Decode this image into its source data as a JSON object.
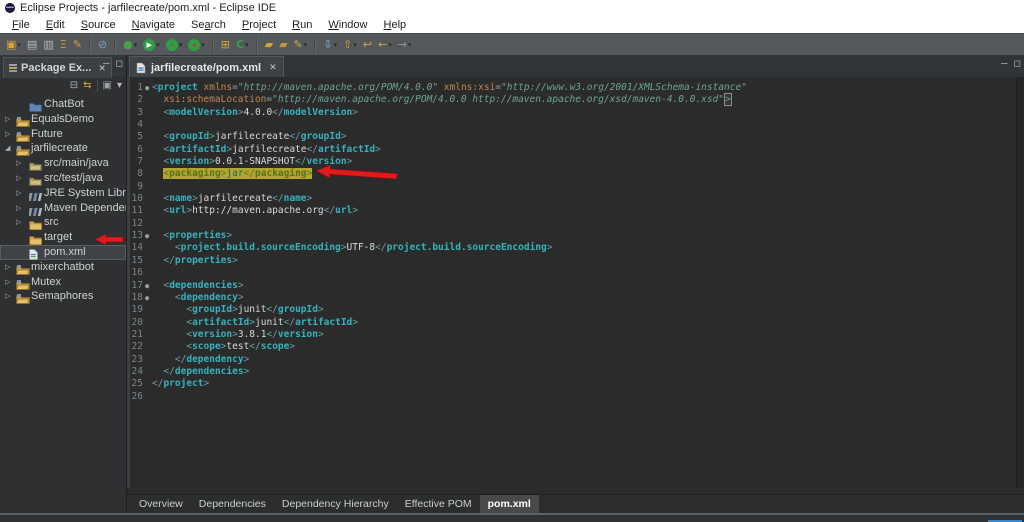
{
  "window": {
    "title": "Eclipse Projects - jarfilecreate/pom.xml - Eclipse IDE"
  },
  "menu": {
    "items": [
      {
        "label": "File",
        "u": 0
      },
      {
        "label": "Edit",
        "u": 0
      },
      {
        "label": "Source",
        "u": 0
      },
      {
        "label": "Navigate",
        "u": 0
      },
      {
        "label": "Search",
        "u": 2
      },
      {
        "label": "Project",
        "u": 0
      },
      {
        "label": "Run",
        "u": 0
      },
      {
        "label": "Window",
        "u": 0
      },
      {
        "label": "Help",
        "u": 0
      }
    ]
  },
  "toolbar": {
    "items": [
      {
        "type": "icon",
        "name": "new-wizard",
        "glyph": "▣",
        "color": "#d9a33c",
        "dropdown": true
      },
      {
        "type": "icon",
        "name": "save",
        "glyph": "▤",
        "color": "#b4babd"
      },
      {
        "type": "icon",
        "name": "save-all",
        "glyph": "▥",
        "color": "#b4babd"
      },
      {
        "type": "icon",
        "name": "build-all",
        "glyph": "Ξ",
        "color": "#d9a33c"
      },
      {
        "type": "icon",
        "name": "open-task",
        "glyph": "✎",
        "color": "#d9a33c"
      },
      {
        "type": "sep"
      },
      {
        "type": "icon",
        "name": "skip-breakpoints",
        "glyph": "⊘",
        "color": "#7f9fc6"
      },
      {
        "type": "sep"
      },
      {
        "type": "icon",
        "name": "debug",
        "glyph": "●",
        "color": "#46a049",
        "dropdown": true
      },
      {
        "type": "icon",
        "name": "run",
        "circle": "#2f9e44",
        "glyph": "▶",
        "color": "#ffffff",
        "dropdown": true
      },
      {
        "type": "icon",
        "name": "coverage",
        "circle": "#2f9e44",
        "glyph": "▪",
        "color": "#c43333",
        "dropdown": true
      },
      {
        "type": "icon",
        "name": "profile",
        "circle": "#2f9e44",
        "glyph": "●",
        "color": "#c43333",
        "dropdown": true
      },
      {
        "type": "sep"
      },
      {
        "type": "icon",
        "name": "new-java-project",
        "glyph": "⊞",
        "color": "#d9a33c"
      },
      {
        "type": "icon",
        "name": "checkout",
        "glyph": "C",
        "color": "#35a04a",
        "dropdown": true
      },
      {
        "type": "sep"
      },
      {
        "type": "icon",
        "name": "open-folder",
        "glyph": "▰",
        "color": "#d9a33c"
      },
      {
        "type": "icon",
        "name": "open-folder-2",
        "glyph": "▰",
        "color": "#c8963a"
      },
      {
        "type": "icon",
        "name": "annotate",
        "glyph": "✎",
        "color": "#c9b05a",
        "dropdown": true
      },
      {
        "type": "sep"
      },
      {
        "type": "icon",
        "name": "import",
        "glyph": "⇩",
        "color": "#8fb0d8",
        "dropdown": true
      },
      {
        "type": "icon",
        "name": "export",
        "glyph": "⇧",
        "color": "#d9a33c",
        "dropdown": true
      },
      {
        "type": "icon",
        "name": "last-edit",
        "glyph": "↩",
        "color": "#d9a33c"
      },
      {
        "type": "icon",
        "name": "back",
        "glyph": "←",
        "color": "#d9a33c",
        "dropdown": true
      },
      {
        "type": "icon",
        "name": "forward",
        "glyph": "→",
        "color": "#95999b",
        "dropdown": true
      }
    ]
  },
  "sidebar": {
    "tab_label": "Package Ex...",
    "tools": [
      {
        "name": "collapse-all",
        "glyph": "⊟",
        "color": "#9fb6c9"
      },
      {
        "name": "link-with-editor",
        "glyph": "⇆",
        "color": "#d9a33c"
      },
      {
        "name": "sep"
      },
      {
        "name": "view-filter",
        "glyph": "▣",
        "color": "#9aa0a3"
      },
      {
        "name": "view-menu",
        "glyph": "▾",
        "color": "#b9bcbd"
      }
    ],
    "tree": [
      {
        "label": "ChatBot",
        "depth": 1,
        "icon": "folder-blue",
        "expander": "none"
      },
      {
        "label": "EqualsDemo",
        "depth": 0,
        "icon": "project",
        "expander": "collapsed"
      },
      {
        "label": "Future",
        "depth": 0,
        "icon": "project",
        "expander": "collapsed"
      },
      {
        "label": "jarfilecreate",
        "depth": 0,
        "icon": "project",
        "expander": "expanded"
      },
      {
        "label": "src/main/java",
        "depth": 1,
        "icon": "package",
        "expander": "collapsed"
      },
      {
        "label": "src/test/java",
        "depth": 1,
        "icon": "package",
        "expander": "collapsed"
      },
      {
        "label": "JRE System Library [",
        "depth": 1,
        "icon": "library",
        "expander": "collapsed"
      },
      {
        "label": "Maven Dependencie",
        "depth": 1,
        "icon": "library",
        "expander": "collapsed"
      },
      {
        "label": "src",
        "depth": 1,
        "icon": "folder",
        "expander": "collapsed"
      },
      {
        "label": "target",
        "depth": 1,
        "icon": "folder",
        "expander": "none"
      },
      {
        "label": "pom.xml",
        "depth": 1,
        "icon": "xmlfile",
        "expander": "none",
        "selected": true
      },
      {
        "label": "mixerchatbot",
        "depth": 0,
        "icon": "project",
        "expander": "collapsed"
      },
      {
        "label": "Mutex",
        "depth": 0,
        "icon": "project",
        "expander": "collapsed"
      },
      {
        "label": "Semaphores",
        "depth": 0,
        "icon": "project",
        "expander": "collapsed"
      }
    ]
  },
  "editor": {
    "tab_label": "jarfilecreate/pom.xml",
    "lines": [
      {
        "n": 1,
        "fold": true,
        "seg": [
          [
            "br",
            "<"
          ],
          [
            "tag",
            "project"
          ],
          [
            "tx",
            " "
          ],
          [
            "attr",
            "xmlns"
          ],
          [
            "eq",
            "="
          ],
          [
            "val",
            "\"http://maven.apache.org/POM/4.0.0\""
          ],
          [
            "tx",
            " "
          ],
          [
            "attr",
            "xmlns:xsi"
          ],
          [
            "eq",
            "="
          ],
          [
            "val",
            "\"http://www.w3.org/2001/XMLSchema-instance\""
          ]
        ]
      },
      {
        "n": 2,
        "seg": [
          [
            "tx",
            "  "
          ],
          [
            "attr",
            "xsi:schemaLocation"
          ],
          [
            "eq",
            "="
          ],
          [
            "val",
            "\"http://maven.apache.org/POM/4.0.0 http://maven.apache.org/xsd/maven-4.0.0.xsd\""
          ],
          [
            "brm",
            ">"
          ]
        ]
      },
      {
        "n": 3,
        "seg": [
          [
            "tx",
            "  "
          ],
          [
            "br",
            "<"
          ],
          [
            "tag",
            "modelVersion"
          ],
          [
            "br",
            ">"
          ],
          [
            "tx",
            "4.0.0"
          ],
          [
            "br",
            "</"
          ],
          [
            "tag",
            "modelVersion"
          ],
          [
            "br",
            ">"
          ]
        ]
      },
      {
        "n": 4,
        "seg": []
      },
      {
        "n": 5,
        "seg": [
          [
            "tx",
            "  "
          ],
          [
            "br",
            "<"
          ],
          [
            "tag",
            "groupId"
          ],
          [
            "br",
            ">"
          ],
          [
            "tx",
            "jarfilecreate"
          ],
          [
            "br",
            "</"
          ],
          [
            "tag",
            "groupId"
          ],
          [
            "br",
            ">"
          ]
        ]
      },
      {
        "n": 6,
        "seg": [
          [
            "tx",
            "  "
          ],
          [
            "br",
            "<"
          ],
          [
            "tag",
            "artifactId"
          ],
          [
            "br",
            ">"
          ],
          [
            "tx",
            "jarfilecreate"
          ],
          [
            "br",
            "</"
          ],
          [
            "tag",
            "artifactId"
          ],
          [
            "br",
            ">"
          ]
        ]
      },
      {
        "n": 7,
        "seg": [
          [
            "tx",
            "  "
          ],
          [
            "br",
            "<"
          ],
          [
            "tag",
            "version"
          ],
          [
            "br",
            ">"
          ],
          [
            "tx",
            "0.0.1-SNAPSHOT"
          ],
          [
            "br",
            "</"
          ],
          [
            "tag",
            "version"
          ],
          [
            "br",
            ">"
          ]
        ]
      },
      {
        "n": 8,
        "seg": [
          [
            "tx",
            "  "
          ],
          [
            "hbr",
            "<"
          ],
          [
            "htag",
            "packaging"
          ],
          [
            "hbr",
            ">"
          ],
          [
            "htx",
            "jar"
          ],
          [
            "hbr",
            "</"
          ],
          [
            "htag",
            "packaging"
          ],
          [
            "hbr",
            ">"
          ]
        ]
      },
      {
        "n": 9,
        "seg": []
      },
      {
        "n": 10,
        "seg": [
          [
            "tx",
            "  "
          ],
          [
            "br",
            "<"
          ],
          [
            "tag",
            "name"
          ],
          [
            "br",
            ">"
          ],
          [
            "tx",
            "jarfilecreate"
          ],
          [
            "br",
            "</"
          ],
          [
            "tag",
            "name"
          ],
          [
            "br",
            ">"
          ]
        ]
      },
      {
        "n": 11,
        "seg": [
          [
            "tx",
            "  "
          ],
          [
            "br",
            "<"
          ],
          [
            "tag",
            "url"
          ],
          [
            "br",
            ">"
          ],
          [
            "tx",
            "http://maven.apache.org"
          ],
          [
            "br",
            "</"
          ],
          [
            "tag",
            "url"
          ],
          [
            "br",
            ">"
          ]
        ]
      },
      {
        "n": 12,
        "seg": []
      },
      {
        "n": 13,
        "fold": true,
        "seg": [
          [
            "tx",
            "  "
          ],
          [
            "br",
            "<"
          ],
          [
            "tag",
            "properties"
          ],
          [
            "br",
            ">"
          ]
        ]
      },
      {
        "n": 14,
        "seg": [
          [
            "tx",
            "    "
          ],
          [
            "br",
            "<"
          ],
          [
            "tag",
            "project.build.sourceEncoding"
          ],
          [
            "br",
            ">"
          ],
          [
            "tx",
            "UTF-8"
          ],
          [
            "br",
            "</"
          ],
          [
            "tag",
            "project.build.sourceEncoding"
          ],
          [
            "br",
            ">"
          ]
        ]
      },
      {
        "n": 15,
        "seg": [
          [
            "tx",
            "  "
          ],
          [
            "br",
            "</"
          ],
          [
            "tag",
            "properties"
          ],
          [
            "br",
            ">"
          ]
        ]
      },
      {
        "n": 16,
        "seg": []
      },
      {
        "n": 17,
        "fold": true,
        "seg": [
          [
            "tx",
            "  "
          ],
          [
            "br",
            "<"
          ],
          [
            "tag",
            "dependencies"
          ],
          [
            "br",
            ">"
          ]
        ]
      },
      {
        "n": 18,
        "fold": true,
        "seg": [
          [
            "tx",
            "    "
          ],
          [
            "br",
            "<"
          ],
          [
            "tag",
            "dependency"
          ],
          [
            "br",
            ">"
          ]
        ]
      },
      {
        "n": 19,
        "seg": [
          [
            "tx",
            "      "
          ],
          [
            "br",
            "<"
          ],
          [
            "tag",
            "groupId"
          ],
          [
            "br",
            ">"
          ],
          [
            "tx",
            "junit"
          ],
          [
            "br",
            "</"
          ],
          [
            "tag",
            "groupId"
          ],
          [
            "br",
            ">"
          ]
        ]
      },
      {
        "n": 20,
        "seg": [
          [
            "tx",
            "      "
          ],
          [
            "br",
            "<"
          ],
          [
            "tag",
            "artifactId"
          ],
          [
            "br",
            ">"
          ],
          [
            "tx",
            "junit"
          ],
          [
            "br",
            "</"
          ],
          [
            "tag",
            "artifactId"
          ],
          [
            "br",
            ">"
          ]
        ]
      },
      {
        "n": 21,
        "seg": [
          [
            "tx",
            "      "
          ],
          [
            "br",
            "<"
          ],
          [
            "tag",
            "version"
          ],
          [
            "br",
            ">"
          ],
          [
            "tx",
            "3.8.1"
          ],
          [
            "br",
            "</"
          ],
          [
            "tag",
            "version"
          ],
          [
            "br",
            ">"
          ]
        ]
      },
      {
        "n": 22,
        "seg": [
          [
            "tx",
            "      "
          ],
          [
            "br",
            "<"
          ],
          [
            "tag",
            "scope"
          ],
          [
            "br",
            ">"
          ],
          [
            "tx",
            "test"
          ],
          [
            "br",
            "</"
          ],
          [
            "tag",
            "scope"
          ],
          [
            "br",
            ">"
          ]
        ]
      },
      {
        "n": 23,
        "seg": [
          [
            "tx",
            "    "
          ],
          [
            "br",
            "</"
          ],
          [
            "tag",
            "dependency"
          ],
          [
            "br",
            ">"
          ]
        ]
      },
      {
        "n": 24,
        "seg": [
          [
            "tx",
            "  "
          ],
          [
            "br",
            "</"
          ],
          [
            "tag",
            "dependencies"
          ],
          [
            "br",
            ">"
          ]
        ]
      },
      {
        "n": 25,
        "seg": [
          [
            "br",
            "</"
          ],
          [
            "tag",
            "project"
          ],
          [
            "br",
            ">"
          ]
        ]
      },
      {
        "n": 26,
        "seg": []
      }
    ]
  },
  "form_tabs": {
    "tabs": [
      "Overview",
      "Dependencies",
      "Dependency Hierarchy",
      "Effective POM",
      "pom.xml"
    ],
    "active": "pom.xml"
  },
  "colors": {
    "tag": "#36b2be",
    "bracket": "#6f9ba1",
    "attr": "#c08552",
    "value": "#6da58c",
    "text": "#d8d8d8",
    "line_no": "#7b878c",
    "highlight_bg": "#b4a52e",
    "highlight_tag": "#55731a",
    "highlight_bracket": "#5d7522",
    "highlight_text": "#17656b",
    "arrow": "#e01b1b",
    "accent_bottom": "#3f84c6"
  }
}
